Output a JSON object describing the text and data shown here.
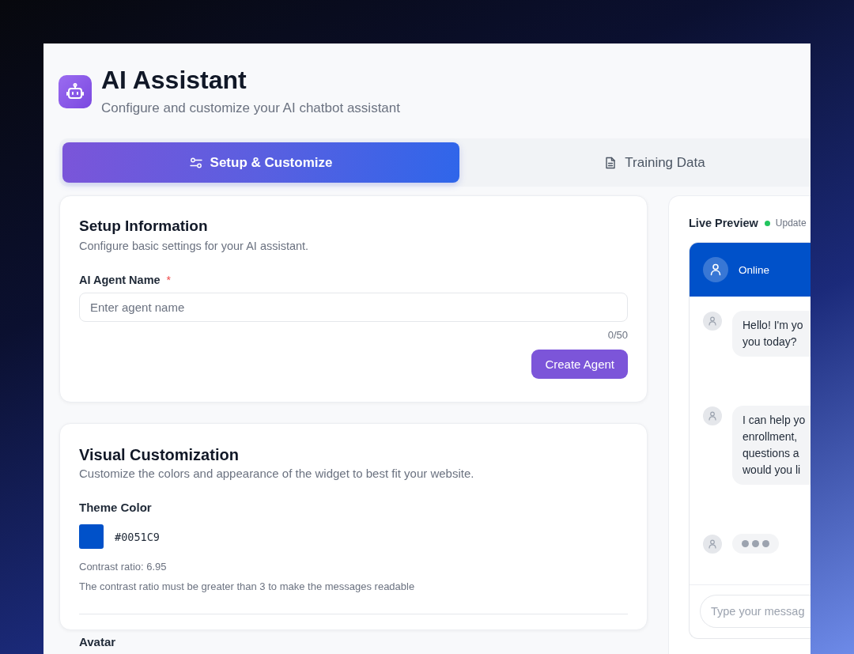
{
  "header": {
    "title": "AI Assistant",
    "subtitle": "Configure and customize your AI chatbot assistant"
  },
  "tabs": [
    {
      "label": "Setup & Customize",
      "selected": true
    },
    {
      "label": "Training Data",
      "selected": false
    }
  ],
  "setup_card": {
    "title": "Setup Information",
    "description": "Configure basic settings for your AI assistant.",
    "field": {
      "label": "AI Agent Name",
      "required_mark": "*",
      "placeholder": "Enter agent name",
      "counter": "0/50"
    },
    "button": "Create Agent"
  },
  "visual_card": {
    "title": "Visual Customization",
    "description": "Customize the colors and appearance of the widget to best fit your website.",
    "theme_color": {
      "label": "Theme Color",
      "value": "#0051C9"
    },
    "contrast": "Contrast ratio: 6.95",
    "hint": "The contrast ratio must be greater than 3 to make the messages readable"
  },
  "avatar_section": {
    "label": "Avatar"
  },
  "preview": {
    "title": "Live Preview",
    "status": "Update",
    "widget": {
      "status": "Online",
      "messages": [
        {
          "kind": "text",
          "lines": [
            "Hello! I'm yo",
            "you today?"
          ]
        },
        {
          "kind": "text",
          "lines": [
            "I can help yo",
            "enrollment,",
            "questions a",
            "would you li"
          ]
        },
        {
          "kind": "typing"
        }
      ],
      "input_placeholder": "Type your messag"
    }
  }
}
